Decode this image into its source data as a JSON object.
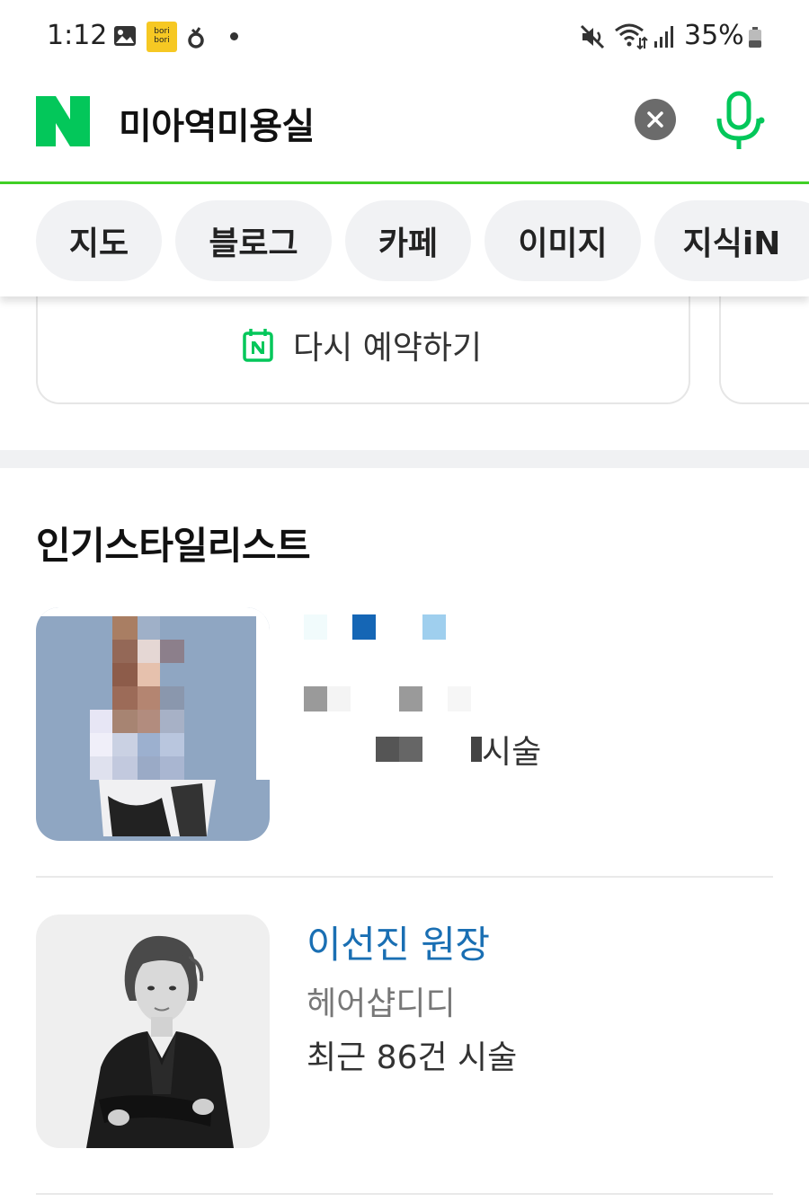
{
  "status_bar": {
    "time": "1:12",
    "notification_app_label": "bori bori",
    "battery": "35%"
  },
  "search": {
    "query": "미아역미용실",
    "logo_letter": "N"
  },
  "tabs": [
    {
      "label": "지도"
    },
    {
      "label": "블로그"
    },
    {
      "label": "카페"
    },
    {
      "label": "이미지"
    },
    {
      "label": "지식iN"
    }
  ],
  "reservation": {
    "button_label": "다시 예약하기",
    "icon_letter": "N"
  },
  "stylists_section": {
    "title": "인기스타일리스트",
    "items": [
      {
        "name": "",
        "shop": "",
        "count_suffix": "시술"
      },
      {
        "name": "이선진 원장",
        "shop": "헤어샵디디",
        "count": "최근 86건 시술"
      }
    ]
  },
  "colors": {
    "naver_green": "#03c75a",
    "name_link": "#1a6fb3"
  }
}
